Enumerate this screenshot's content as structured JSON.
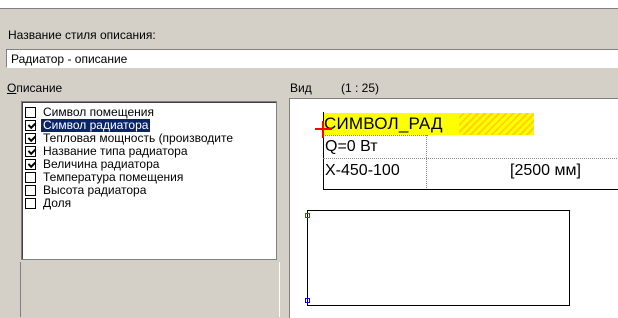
{
  "style_name": {
    "label": "Название стиля описания:",
    "value": "Радиатор - описание"
  },
  "description": {
    "label_first": "О",
    "label_rest": "писание",
    "items": [
      {
        "label": "Символ помещения",
        "checked": false,
        "selected": false
      },
      {
        "label": "Символ радиатора",
        "checked": true,
        "selected": true
      },
      {
        "label": "Тепловая мощность (производите",
        "checked": true,
        "selected": false
      },
      {
        "label": "Название типа радиатора",
        "checked": true,
        "selected": false
      },
      {
        "label": "Величина радиатора",
        "checked": true,
        "selected": false
      },
      {
        "label": "Температура помещения",
        "checked": false,
        "selected": false
      },
      {
        "label": "Высота радиатора",
        "checked": false,
        "selected": false
      },
      {
        "label": "Доля",
        "checked": false,
        "selected": false
      }
    ]
  },
  "view": {
    "label": "Вид",
    "scale": "(1 : 25)",
    "symbol_text": "СИМВОЛ_РАД",
    "power_text": "Q=0 Вт",
    "type_text": "X-450-100",
    "size_text": "[2500 мм]"
  },
  "colors": {
    "highlight": "#ffff00",
    "selection": "#0a246a",
    "insert_marker": "#ff0000",
    "grip_top": "#ff0000",
    "grip_bottom": "#0000ff"
  }
}
